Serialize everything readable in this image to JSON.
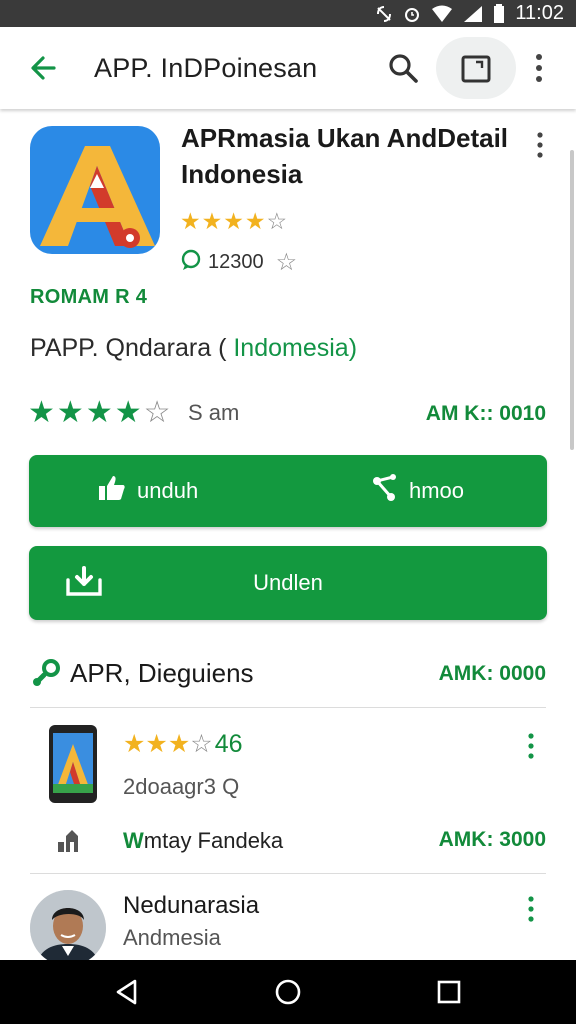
{
  "status_bar": {
    "time": "11:02"
  },
  "app_bar": {
    "title": "APP. InDPoinesan"
  },
  "app": {
    "name": "APRmasia Ukan AndDetail Indonesia",
    "rating_stars": 4,
    "downloads": "12300",
    "developer": "ROMAM R 4",
    "subtitle_prefix": "PAPP. Qndarara (",
    "subtitle_highlight": "Indomesia)",
    "user_rating_stars": 4,
    "rating_text": "S am",
    "meta": "AM K:: 0010"
  },
  "buttons": {
    "primary_left": "unduh",
    "primary_right": "hmoo",
    "secondary": "Undlen"
  },
  "section": {
    "title": "APR, Dieguiens",
    "meta": "AMK: 0000"
  },
  "items": [
    {
      "rating_stars": 3,
      "rating_value": "46",
      "sub": "2doaagr3 Q",
      "label_bold": "W",
      "label_rest": "mtay Fandeka",
      "meta": "AMK: 3000"
    },
    {
      "name": "Nedunarasia",
      "sub": "Andmesia"
    }
  ],
  "colors": {
    "accent": "#13993f",
    "star": "#f2b21f",
    "status_bar": "#3a3a3a"
  }
}
